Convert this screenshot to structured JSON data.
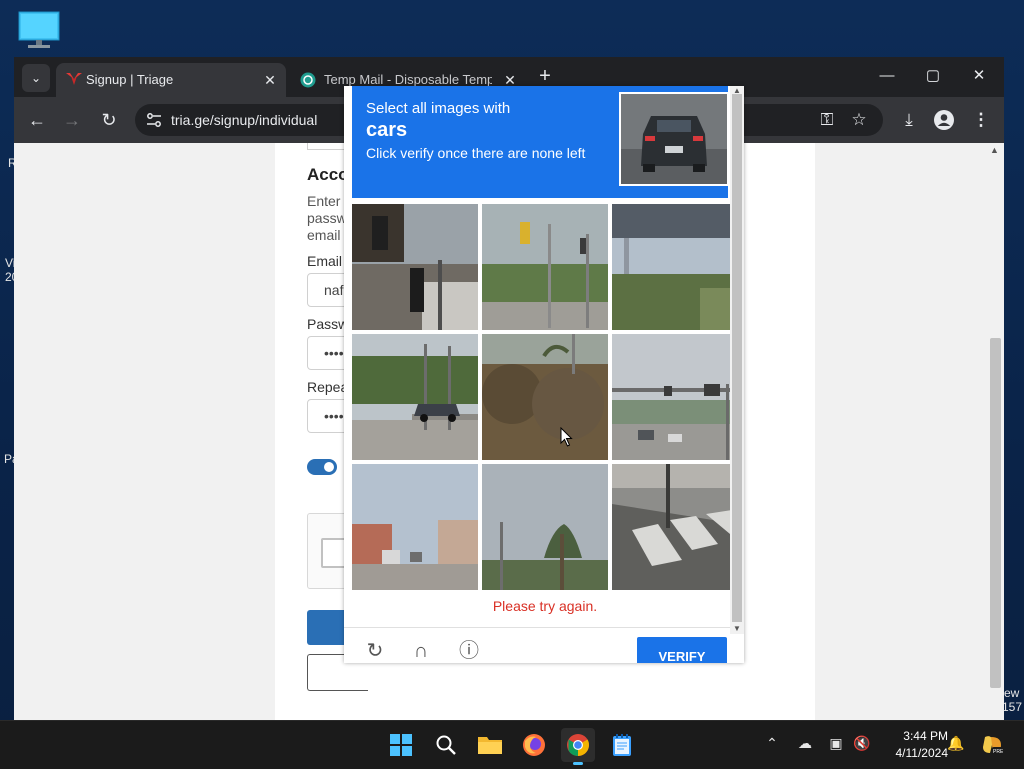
{
  "desktop": {
    "left_fragments": [
      "R",
      "Vi",
      "20",
      "Pa"
    ],
    "right_fragments": [
      "ew",
      "157"
    ]
  },
  "browser": {
    "tabs": [
      {
        "title": "Signup | Triage",
        "active": true
      },
      {
        "title": "Temp Mail - Disposable Tempor",
        "active": false
      }
    ],
    "url": "tria.ge/signup/individual"
  },
  "signup": {
    "account_heading": "Accou",
    "intro": "Enter yo passwo email ac",
    "email_label": "Email",
    "email_value": "nafeg",
    "password_label": "Passwo",
    "password_value": "•••••••",
    "repeat_label": "Repeat",
    "repeat_value": "•••••••"
  },
  "captcha": {
    "prompt_line1": "Select all images with",
    "prompt_object": "cars",
    "prompt_line3": "Click verify once there are none left",
    "error": "Please try again.",
    "verify_label": "VERIFY"
  },
  "taskbar": {
    "time": "3:44 PM",
    "date": "4/11/2024"
  }
}
